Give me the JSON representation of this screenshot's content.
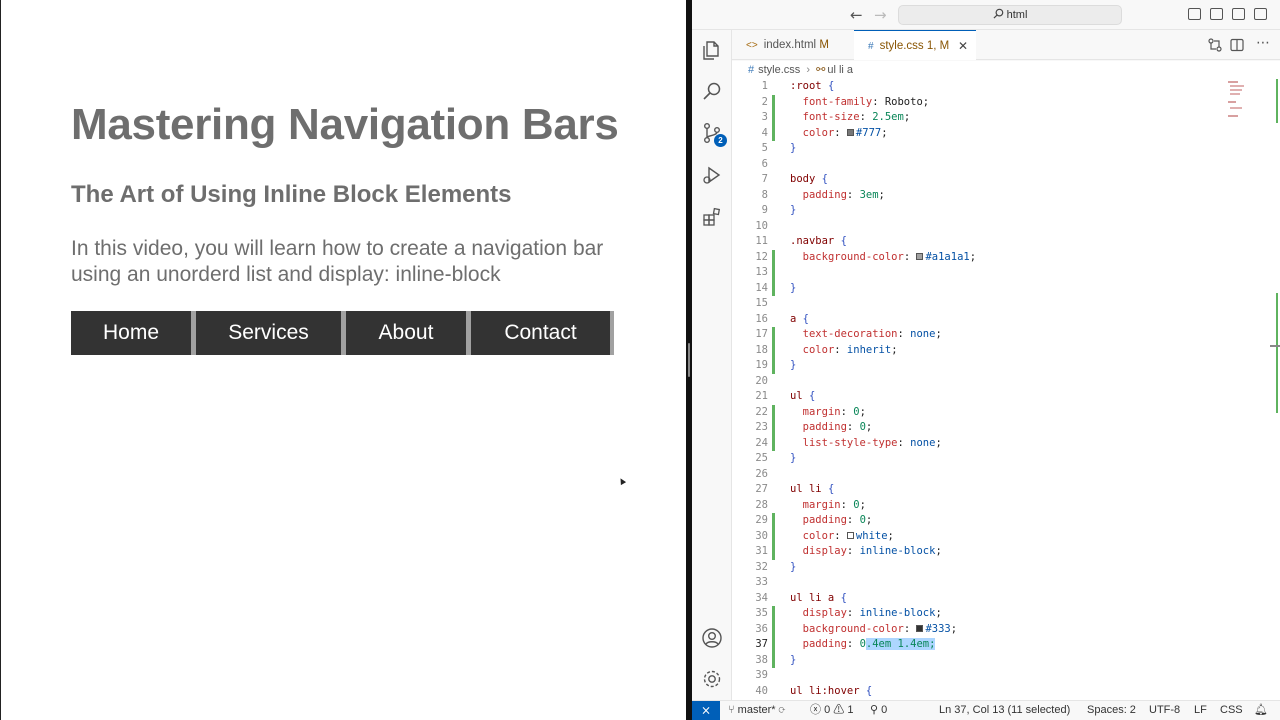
{
  "preview": {
    "heading": "Mastering Navigation Bars",
    "subheading": "The Art of Using Inline Block Elements",
    "paragraph": "In this video, you will learn how to create a navigation bar using an unorderd list and display: inline-block",
    "nav_items": [
      {
        "label": "Home"
      },
      {
        "label": "Services"
      },
      {
        "label": "About"
      },
      {
        "label": "Contact"
      }
    ]
  },
  "titlebar": {
    "search_text": "html",
    "back_icon": "arrow-left-icon",
    "forward_icon": "arrow-right-icon"
  },
  "tabs": [
    {
      "label": "index.html",
      "status": "M",
      "icon": "html-file-icon"
    },
    {
      "label": "style.css",
      "status": "1, M",
      "icon": "css-file-icon"
    }
  ],
  "breadcrumb": {
    "file": "style.css",
    "symbol": "ul li a"
  },
  "activity_badge": "2",
  "code": [
    {
      "n": "1",
      "html": "<span class=\"tk-sel\">:root</span> <span class=\"tk-brace\">{</span>"
    },
    {
      "n": "2",
      "html": "  <span class=\"tk-prop\">font-family</span>: Roboto;"
    },
    {
      "n": "3",
      "html": "  <span class=\"tk-prop\">font-size</span>: <span class=\"tk-num\">2.5em</span>;"
    },
    {
      "n": "4",
      "html": "  <span class=\"tk-prop\">color</span>: <span class=\"swatch\" style=\"background:#777\"></span><span class=\"tk-val\">#777</span>;"
    },
    {
      "n": "5",
      "html": "<span class=\"tk-brace\">}</span>"
    },
    {
      "n": "6",
      "html": ""
    },
    {
      "n": "7",
      "html": "<span class=\"tk-sel\">body</span> <span class=\"tk-brace\">{</span>"
    },
    {
      "n": "8",
      "html": "  <span class=\"tk-prop\">padding</span>: <span class=\"tk-num\">3em</span>;"
    },
    {
      "n": "9",
      "html": "<span class=\"tk-brace\">}</span>"
    },
    {
      "n": "10",
      "html": ""
    },
    {
      "n": "11",
      "html": "<span class=\"tk-sel\">.navbar</span> <span class=\"tk-brace\">{</span>"
    },
    {
      "n": "12",
      "html": "  <span class=\"tk-prop\">background-color</span>: <span class=\"swatch\" style=\"background:#a1a1a1\"></span><span class=\"tk-val\">#a1a1a1</span>;"
    },
    {
      "n": "13",
      "html": ""
    },
    {
      "n": "14",
      "html": "<span class=\"tk-brace\">}</span>"
    },
    {
      "n": "15",
      "html": ""
    },
    {
      "n": "16",
      "html": "<span class=\"tk-sel\">a</span> <span class=\"tk-brace\">{</span>"
    },
    {
      "n": "17",
      "html": "  <span class=\"tk-prop\">text-decoration</span>: <span class=\"tk-val\">none</span>;"
    },
    {
      "n": "18",
      "html": "  <span class=\"tk-prop\">color</span>: <span class=\"tk-val\">inherit</span>;"
    },
    {
      "n": "19",
      "html": "<span class=\"tk-brace\">}</span>"
    },
    {
      "n": "20",
      "html": ""
    },
    {
      "n": "21",
      "html": "<span class=\"tk-sel\">ul</span> <span class=\"tk-brace\">{</span>"
    },
    {
      "n": "22",
      "html": "  <span class=\"tk-prop\">margin</span>: <span class=\"tk-num\">0</span>;"
    },
    {
      "n": "23",
      "html": "  <span class=\"tk-prop\">padding</span>: <span class=\"tk-num\">0</span>;"
    },
    {
      "n": "24",
      "html": "  <span class=\"tk-prop\">list-style-type</span>: <span class=\"tk-val\">none</span>;"
    },
    {
      "n": "25",
      "html": "<span class=\"tk-brace\">}</span>"
    },
    {
      "n": "26",
      "html": ""
    },
    {
      "n": "27",
      "html": "<span class=\"tk-sel\">ul li</span> <span class=\"tk-brace\">{</span>"
    },
    {
      "n": "28",
      "html": "  <span class=\"tk-prop\">margin</span>: <span class=\"tk-num\">0</span>;"
    },
    {
      "n": "29",
      "html": "  <span class=\"tk-prop\">padding</span>: <span class=\"tk-num\">0</span>;"
    },
    {
      "n": "30",
      "html": "  <span class=\"tk-prop\">color</span>: <span class=\"swatch\" style=\"background:#fff\"></span><span class=\"tk-val\">white</span>;"
    },
    {
      "n": "31",
      "html": "  <span class=\"tk-prop\">display</span>: <span class=\"tk-val\">inline-block</span>;"
    },
    {
      "n": "32",
      "html": "<span class=\"tk-brace\">}</span>"
    },
    {
      "n": "33",
      "html": ""
    },
    {
      "n": "34",
      "html": "<span class=\"tk-sel\">ul li a</span> <span class=\"tk-brace\">{</span>"
    },
    {
      "n": "35",
      "html": "  <span class=\"tk-prop\">display</span>: <span class=\"tk-val\">inline-block</span>;"
    },
    {
      "n": "36",
      "html": "  <span class=\"tk-prop\">background-color</span>: <span class=\"swatch\" style=\"background:#333\"></span><span class=\"tk-val\">#333</span>;"
    },
    {
      "n": "37",
      "html": "  <span class=\"tk-prop\">padding</span>: <span class=\"tk-num\">0<span class=\"sel-hl\">.4em 1.4em;</span></span>",
      "current": true
    },
    {
      "n": "38",
      "html": "<span class=\"tk-brace\">}</span>"
    },
    {
      "n": "39",
      "html": ""
    },
    {
      "n": "40",
      "html": "<span class=\"tk-sel\">ul li:hover</span> <span class=\"tk-brace\">{</span>"
    }
  ],
  "statusbar": {
    "branch": "master*",
    "errors": "0",
    "warnings": "1",
    "ports": "0",
    "position": "Ln 37, Col 13 (11 selected)",
    "spaces": "Spaces: 2",
    "encoding": "UTF-8",
    "eol": "LF",
    "language": "CSS"
  },
  "colors": {
    "accent": "#005fb8",
    "nav_bg": "#a1a1a1",
    "nav_item_bg": "#333333",
    "text_gray": "#777777",
    "gutter_modified": "#5fb35f"
  }
}
